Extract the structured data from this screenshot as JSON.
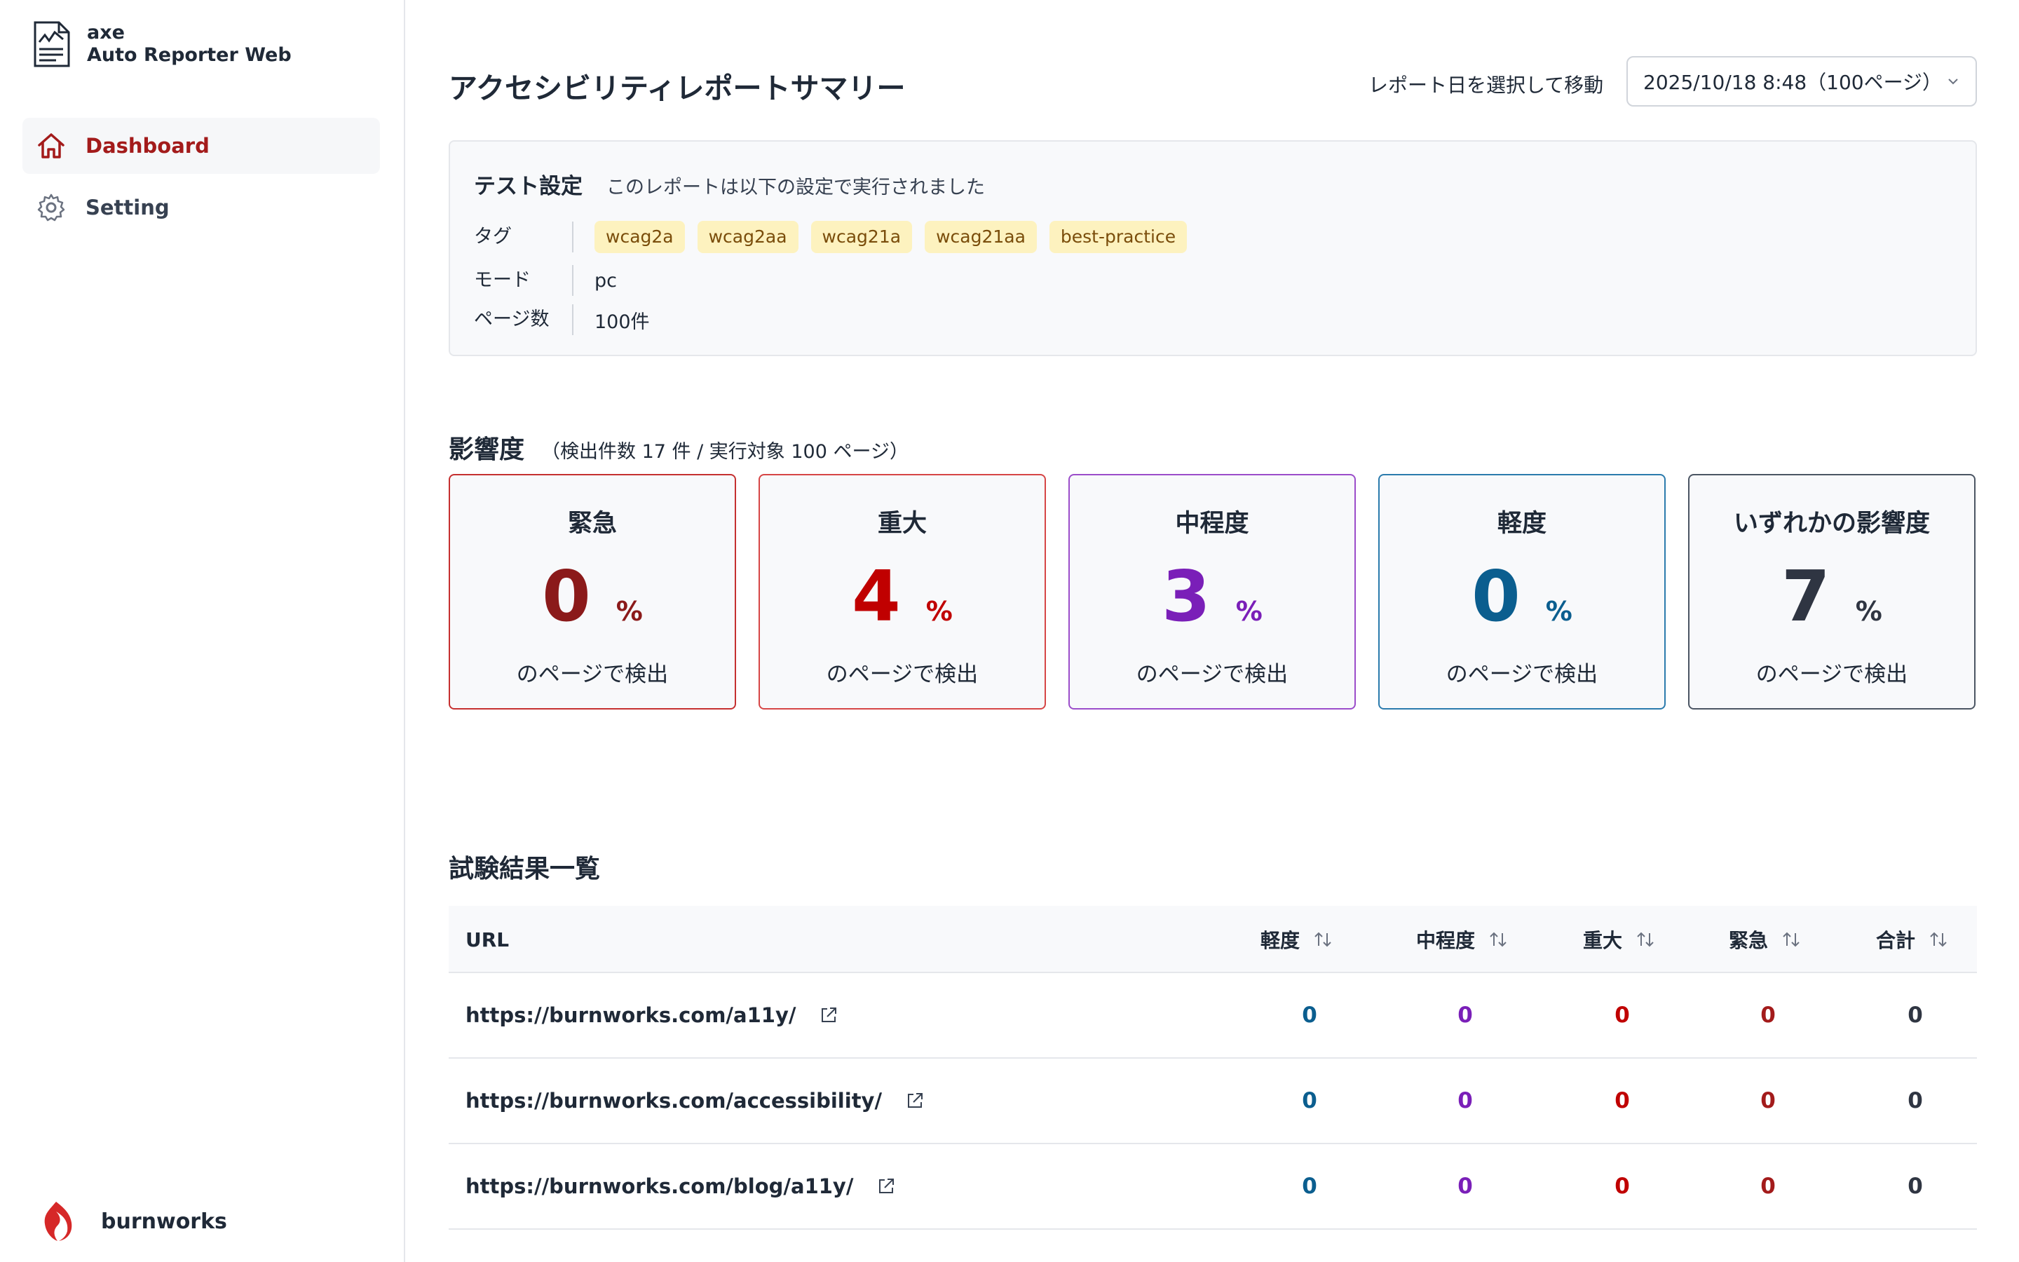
{
  "app": {
    "brand_line1": "axe",
    "brand_line2": "Auto Reporter Web",
    "footer_label": "burnworks"
  },
  "sidebar": {
    "items": [
      {
        "label": "Dashboard",
        "icon": "home-icon",
        "active": true
      },
      {
        "label": "Setting",
        "icon": "gear-icon",
        "active": false
      }
    ]
  },
  "header": {
    "title": "アクセシビリティレポートサマリー",
    "select_label": "レポート日を選択して移動",
    "select_value": "2025/10/18 8:48（100ページ）"
  },
  "settings": {
    "title": "テスト設定",
    "description": "このレポートは以下の設定で実行されました",
    "tag_key": "タグ",
    "tags": [
      "wcag2a",
      "wcag2aa",
      "wcag21a",
      "wcag21aa",
      "best-practice"
    ],
    "mode_key": "モード",
    "mode_value": "pc",
    "pages_key": "ページ数",
    "pages_value": "100件"
  },
  "impact": {
    "title": "影響度",
    "subtitle": "（検出件数 17 件 / 実行対象 100 ページ）",
    "cards": [
      {
        "title": "緊急",
        "value": "0",
        "unit": "%",
        "footer": "のページで検出",
        "color": "#8b1a1a",
        "border": "#c53030"
      },
      {
        "title": "重大",
        "value": "4",
        "unit": "%",
        "footer": "のページで検出",
        "color": "#c00000",
        "border": "#d64545"
      },
      {
        "title": "中程度",
        "value": "3",
        "unit": "%",
        "footer": "のページで検出",
        "color": "#7a1fb8",
        "border": "#9b4dca"
      },
      {
        "title": "軽度",
        "value": "0",
        "unit": "%",
        "footer": "のページで検出",
        "color": "#0b5e8f",
        "border": "#2b7bad"
      },
      {
        "title": "いずれかの影響度",
        "value": "7",
        "unit": "%",
        "footer": "のページで検出",
        "color": "#2f3542",
        "border": "#4b5563"
      }
    ]
  },
  "results": {
    "title": "試験結果一覧",
    "columns": {
      "url": "URL",
      "minor": "軽度",
      "moderate": "中程度",
      "serious": "重大",
      "critical": "緊急",
      "total": "合計"
    },
    "rows": [
      {
        "url": "https://burnworks.com/a11y/",
        "minor": "0",
        "moderate": "0",
        "serious": "0",
        "critical": "0",
        "total": "0"
      },
      {
        "url": "https://burnworks.com/accessibility/",
        "minor": "0",
        "moderate": "0",
        "serious": "0",
        "critical": "0",
        "total": "0"
      },
      {
        "url": "https://burnworks.com/blog/a11y/",
        "minor": "0",
        "moderate": "0",
        "serious": "0",
        "critical": "0",
        "total": "0"
      }
    ]
  },
  "colors": {
    "accent": "#a31b1b",
    "minor": "#0b5e8f",
    "moderate": "#7a1fb8",
    "serious": "#c00000",
    "critical": "#a31b1b",
    "total": "#2f3542"
  }
}
